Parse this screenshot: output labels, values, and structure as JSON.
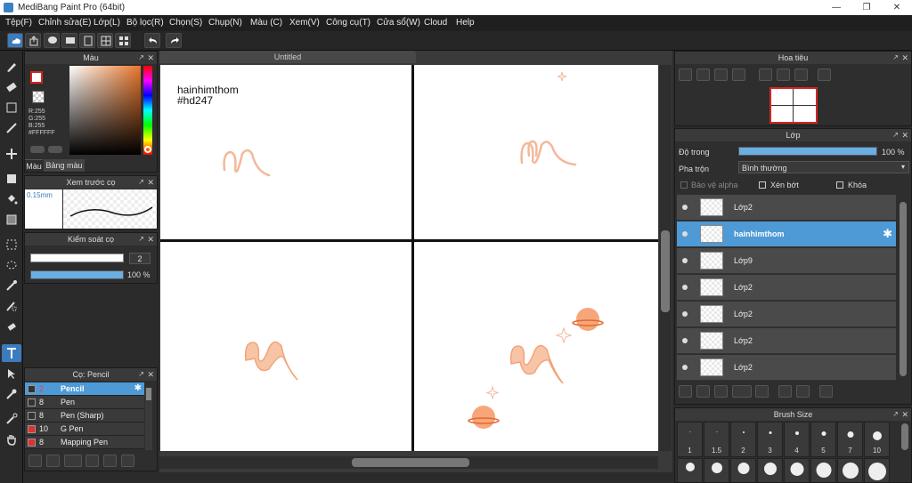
{
  "window": {
    "title": "MediBang Paint Pro (64bit)",
    "minimize": "—",
    "maximize": "❐",
    "close": "✕"
  },
  "menu": [
    "Tệp(F)",
    "Chỉnh sửa(E)",
    "Lớp(L)",
    "Bộ lọc(R)",
    "Chọn(S)",
    "Chụp(N)",
    "Màu (C)",
    "Xem(V)",
    "Công cụ(T)",
    "Cửa sổ(W)",
    "Cloud",
    "Help"
  ],
  "color_panel": {
    "title": "Màu",
    "r": "R:255",
    "g": "G:255",
    "b": "B:255",
    "hex": "#FFFFFF",
    "tab_color": "Màu",
    "tab_palette": "Bảng màu",
    "accent": "#d4261f"
  },
  "brush_preview": {
    "title": "Xem trước cọ",
    "size": "0.15mm"
  },
  "brush_control": {
    "title": "Kiểm soát cọ",
    "size_value": "2",
    "opacity_value": "100 %",
    "opacity_fraction": 1.0
  },
  "brush_list": {
    "title": "Cọ: Pencil",
    "items": [
      {
        "num": "2",
        "name": "Pencil",
        "color": "#333333",
        "selected": true
      },
      {
        "num": "8",
        "name": "Pen",
        "color": "#333333",
        "selected": false
      },
      {
        "num": "8",
        "name": "Pen (Sharp)",
        "color": "#333333",
        "selected": false
      },
      {
        "num": "10",
        "name": "G Pen",
        "color": "#e03030",
        "selected": false
      },
      {
        "num": "8",
        "name": "Mapping Pen",
        "color": "#e03030",
        "selected": false
      }
    ]
  },
  "canvas": {
    "tab": "Untitled",
    "watermark_line1": "hainhimthom",
    "watermark_line2": "#hd247",
    "stroke_color": "#f4b89a",
    "planet_color": "#f2874f"
  },
  "navigator": {
    "title": "Hoa tiêu"
  },
  "layer_panel": {
    "title": "Lớp",
    "opacity_label": "Độ trong",
    "opacity_value": "100 %",
    "opacity_fraction": 1.0,
    "blend_label": "Pha trộn",
    "blend_value": "Bình thường",
    "protect_alpha": "Bảo vệ alpha",
    "clipping": "Xén bớt",
    "lock": "Khóa",
    "layers": [
      {
        "name": "Lớp2",
        "selected": false
      },
      {
        "name": "hainhimthom",
        "selected": true
      },
      {
        "name": "Lớp9",
        "selected": false
      },
      {
        "name": "Lớp2",
        "selected": false
      },
      {
        "name": "Lớp2",
        "selected": false
      },
      {
        "name": "Lớp2",
        "selected": false
      },
      {
        "name": "Lớp2",
        "selected": false
      }
    ]
  },
  "brush_size": {
    "title": "Brush Size",
    "sizes": [
      "1",
      "1.5",
      "2",
      "3",
      "4",
      "5",
      "7",
      "10"
    ]
  }
}
